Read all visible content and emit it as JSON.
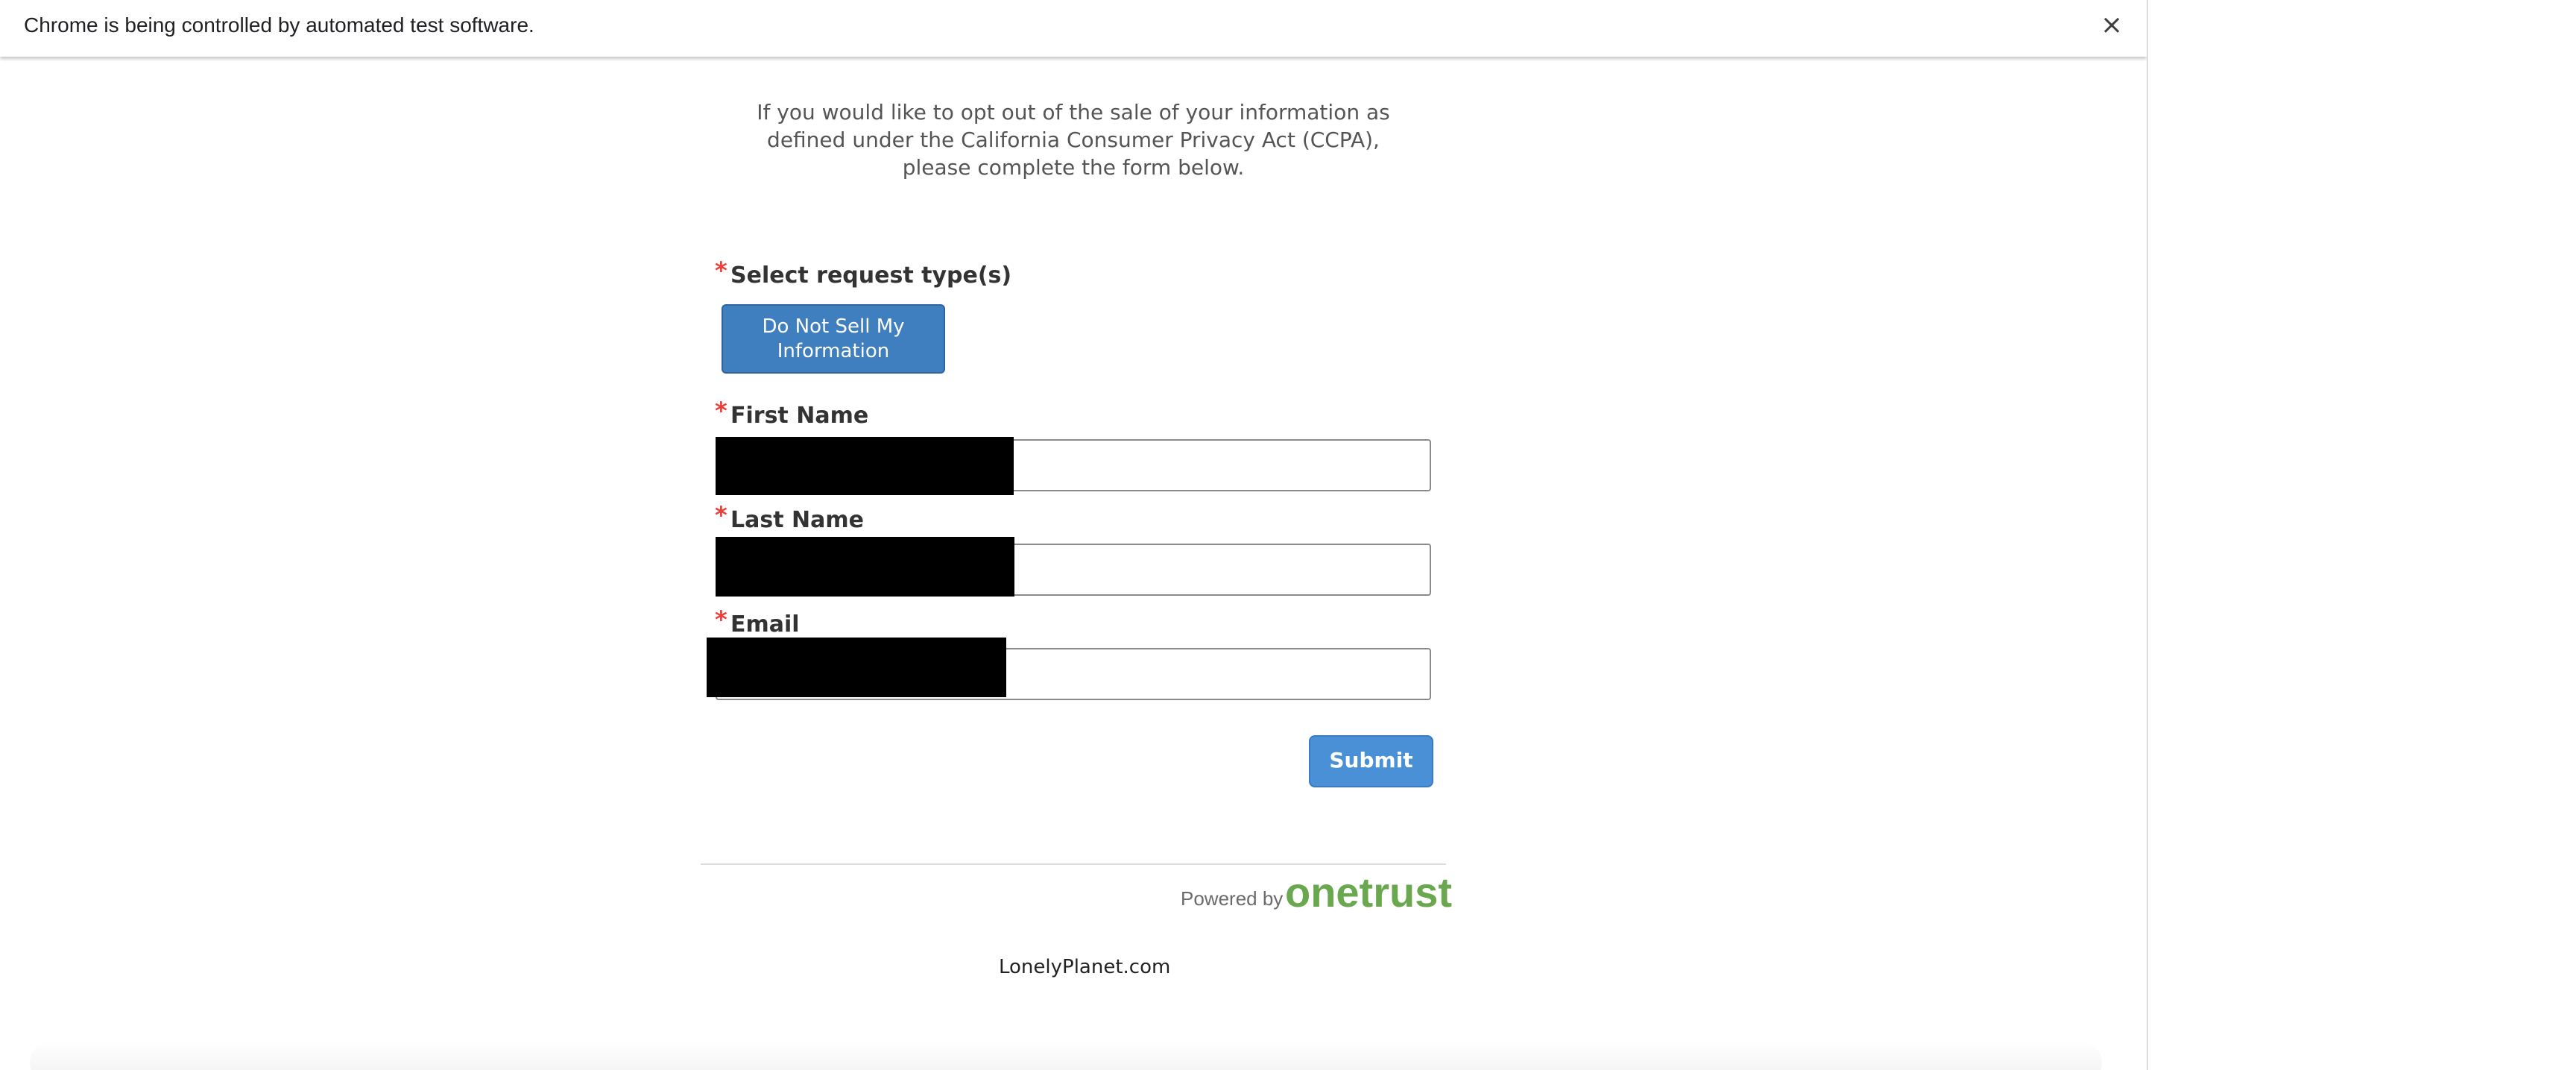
{
  "browser": {
    "infobar_text": "Chrome is being controlled by automated test software.",
    "close_symbol": "×"
  },
  "form": {
    "intro_text": "If you would like to opt out of the sale of your information as defined under the California Consumer Privacy Act (CCPA), please complete the form below.",
    "required_mark": "*",
    "request_type": {
      "label": "Select request type(s)",
      "option_label": "Do Not Sell My Information",
      "option_selected": true
    },
    "first_name": {
      "label": "First Name",
      "value": ""
    },
    "last_name": {
      "label": "Last Name",
      "value": ""
    },
    "email": {
      "label": "Email",
      "value": ""
    },
    "submit_label": "Submit"
  },
  "footer": {
    "powered_by": "Powered by",
    "brand_logo": "onetrust",
    "site_name": "LonelyPlanet.com"
  },
  "colors": {
    "primary_button": "#3f7fc0",
    "submit_button": "#4a90d6",
    "required": "#e8403a",
    "onetrust_green": "#6aa84f"
  },
  "icons": {
    "close": "close-icon"
  }
}
